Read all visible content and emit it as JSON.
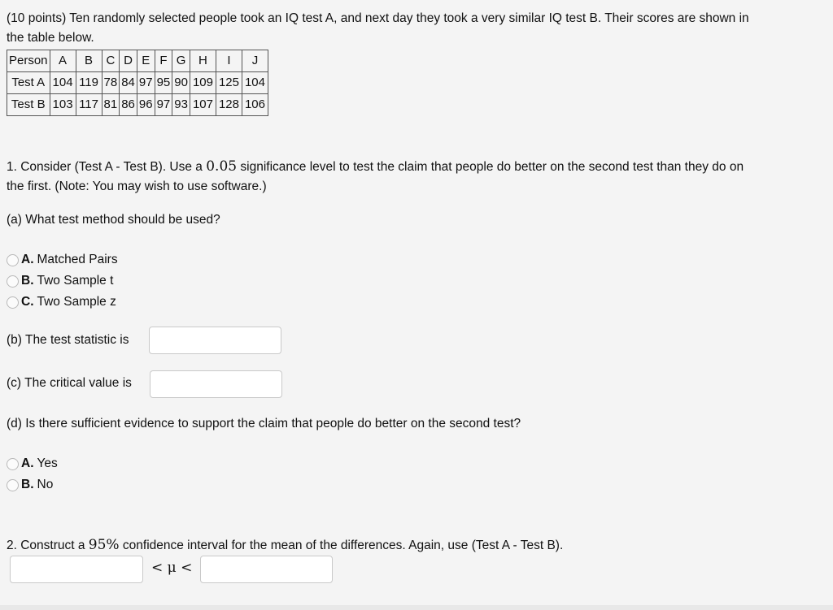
{
  "intro": {
    "line1": "(10 points) Ten randomly selected people took an IQ test A, and next day they took a very similar IQ test B. Their scores are shown in",
    "line2": "the table below."
  },
  "table": {
    "header": [
      "Person",
      "A",
      "B",
      "C",
      "D",
      "E",
      "F",
      "G",
      "H",
      "I",
      "J"
    ],
    "rows": [
      [
        "Test A",
        "104",
        "119",
        "78",
        "84",
        "97",
        "95",
        "90",
        "109",
        "125",
        "104"
      ],
      [
        "Test B",
        "103",
        "117",
        "81",
        "86",
        "96",
        "97",
        "93",
        "107",
        "128",
        "106"
      ]
    ]
  },
  "q1": {
    "text_pre": "1. Consider (Test A - Test B). Use a ",
    "alpha": "0.05",
    "text_post": " significance level to test the claim that people do better on the second test than they do on",
    "line2": "the first. (Note: You may wish to use software.)",
    "a": {
      "prompt": "(a) What test method should be used?",
      "options": [
        {
          "letter": "A.",
          "label": "Matched Pairs"
        },
        {
          "letter": "B.",
          "label": "Two Sample t"
        },
        {
          "letter": "C.",
          "label": "Two Sample z"
        }
      ]
    },
    "b": {
      "prompt": "(b) The test statistic is",
      "value": ""
    },
    "c": {
      "prompt": "(c) The critical value is",
      "value": ""
    },
    "d": {
      "prompt": "(d) Is there sufficient evidence to support the claim that people do better on the second test?",
      "options": [
        {
          "letter": "A.",
          "label": "Yes"
        },
        {
          "letter": "B.",
          "label": "No"
        }
      ]
    }
  },
  "q2": {
    "text_pre": "2. Construct a ",
    "confidence": "95%",
    "text_post": " confidence interval for the mean of the differences. Again, use (Test A - Test B).",
    "mu_symbol": "< μ <",
    "lower": "",
    "upper": ""
  }
}
